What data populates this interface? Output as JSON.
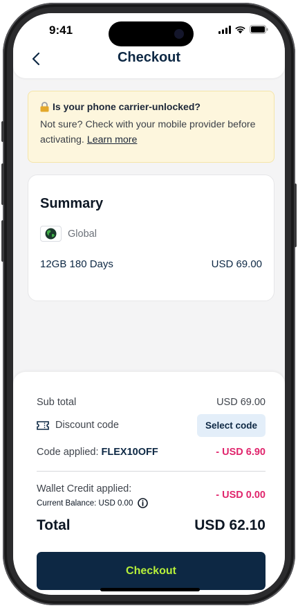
{
  "status_bar": {
    "time": "9:41"
  },
  "header": {
    "title": "Checkout"
  },
  "warning": {
    "title": "Is your phone carrier-unlocked?",
    "text": "Not sure? Check with your mobile provider before activating.",
    "link": "Learn more"
  },
  "summary": {
    "title": "Summary",
    "region": "Global",
    "plan": "12GB 180 Days",
    "price": "USD 69.00"
  },
  "totals": {
    "subtotal_label": "Sub total",
    "subtotal_value": "USD 69.00",
    "discount_label": "Discount code",
    "select_code_label": "Select code",
    "code_applied_label": "Code applied:",
    "code_name": "FLEX10OFF",
    "code_discount": "- USD 6.90",
    "wallet_label": "Wallet Credit applied:",
    "balance_label": "Current Balance: USD 0.00",
    "wallet_value": "- USD 0.00",
    "total_label": "Total",
    "total_value": "USD 62.10"
  },
  "checkout_button": "Checkout",
  "colors": {
    "navy": "#0d2844",
    "accent_green": "#b7f03a",
    "discount_red": "#e0256c",
    "warning_bg": "#fdf6dd",
    "chip_bg": "#e3eef9"
  },
  "icons": [
    "back-chevron",
    "signal",
    "wifi",
    "battery",
    "lock",
    "globe",
    "ticket",
    "info"
  ]
}
